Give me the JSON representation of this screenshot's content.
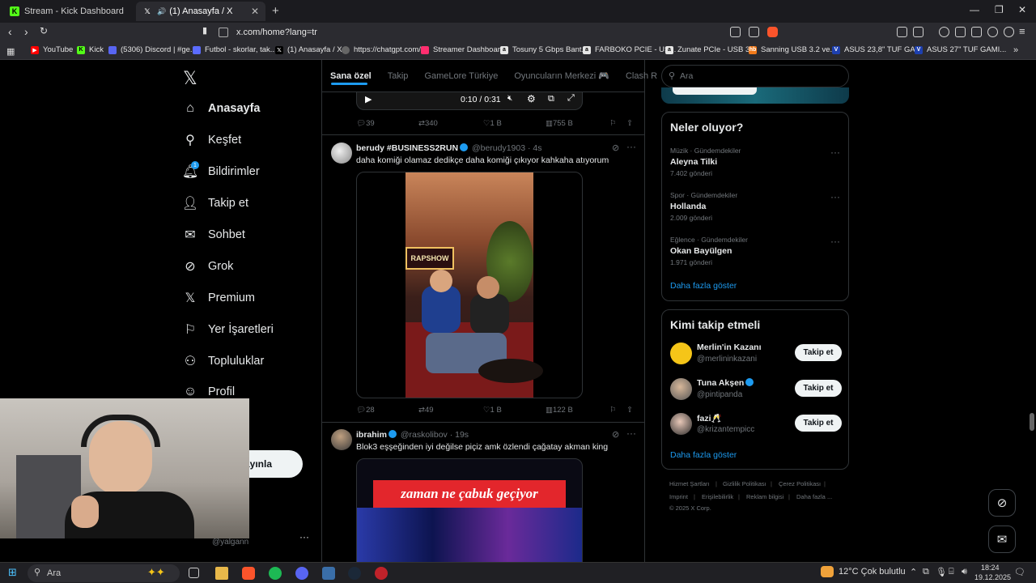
{
  "tabs": [
    {
      "label": "Stream - Kick Dashboard",
      "icon": "kick-icon",
      "color": "#53fc18"
    },
    {
      "label": "(1) Anasayfa / X",
      "icon": "x-logo-icon",
      "color": "#ffffff"
    }
  ],
  "url": "x.com/home?lang=tr",
  "bookmarks": [
    {
      "label": "YouTube",
      "color": "#ff0000"
    },
    {
      "label": "Kick",
      "color": "#53fc18"
    },
    {
      "label": "(5306) Discord | #ge...",
      "color": "#5865f2"
    },
    {
      "label": "Futbol - skorlar, tak...",
      "color": "#5b6cff"
    },
    {
      "label": "(1) Anasayfa / X",
      "color": "#444444"
    },
    {
      "label": "https://chatgpt.com/",
      "color": "#666666"
    },
    {
      "label": "Streamer Dashboard",
      "color": "#ff2e6f"
    },
    {
      "label": "Tosuny 5 Gbps Bant...",
      "color": "#e6e6e6"
    },
    {
      "label": "FARBOKO PCIE - US...",
      "color": "#e6e6e6"
    },
    {
      "label": "Zunate PCIe - USB 3...",
      "color": "#e6e6e6"
    },
    {
      "label": "Sanning USB 3.2 ve...",
      "color": "#f27a1a"
    },
    {
      "label": "ASUS 23,8\" TUF GA...",
      "color": "#1e40af"
    },
    {
      "label": "ASUS 27\" TUF GAMI...",
      "color": "#1e40af"
    }
  ],
  "nav": [
    {
      "label": "Anasayfa",
      "icon": "home-icon"
    },
    {
      "label": "Keşfet",
      "icon": "search-icon"
    },
    {
      "label": "Bildirimler",
      "icon": "bell-icon",
      "badge": "1"
    },
    {
      "label": "Takip et",
      "icon": "add-user-icon"
    },
    {
      "label": "Sohbet",
      "icon": "mail-icon"
    },
    {
      "label": "Grok",
      "icon": "grok-icon"
    },
    {
      "label": "Premium",
      "icon": "x-logo-icon"
    },
    {
      "label": "Yer İşaretleri",
      "icon": "bookmark-icon"
    },
    {
      "label": "Topluluklar",
      "icon": "communities-icon"
    },
    {
      "label": "Profil",
      "icon": "profile-icon"
    },
    {
      "label": "zla",
      "icon": ""
    }
  ],
  "post_button_partial": "ayınla",
  "account_handle_partial": "@yalgann",
  "feed_tabs": [
    "Sana özel",
    "Takip",
    "GameLore Türkiye",
    "Oyuncuların Merkezi 🎮",
    "Clash R"
  ],
  "video_time": "0:10 / 0:31",
  "tweets": [
    {
      "actions": {
        "replies": "39",
        "reposts": "340",
        "likes": "1 B",
        "views": "755 B"
      }
    },
    {
      "name": "berudy #BUSINESS2RUN",
      "verified": true,
      "handle": "@berudy1903 · 4s",
      "text": "daha komiği olamaz dedikçe daha komiği çıkıyor kahkaha atıyorum",
      "media_sign": "RAPSHOW",
      "actions": {
        "replies": "28",
        "reposts": "49",
        "likes": "1 B",
        "views": "122 B"
      }
    },
    {
      "name": "ibrahim",
      "verified": true,
      "handle": "@raskolibov · 19s",
      "text": "Blok3 eşşeğinden iyi değilse piçiz amk özlendi çağatay akman king",
      "media_caption": "zaman ne çabuk geçiyor"
    }
  ],
  "search_placeholder": "Ara",
  "trends": {
    "title": "Neler oluyor?",
    "items": [
      {
        "meta": "Müzik · Gündemdekiler",
        "topic": "Aleyna Tilki",
        "posts": "7.402 gönderi"
      },
      {
        "meta": "Spor · Gündemdekiler",
        "topic": "Hollanda",
        "posts": "2.009 gönderi"
      },
      {
        "meta": "Eğlence · Gündemdekiler",
        "topic": "Okan Bayülgen",
        "posts": "1.971 gönderi"
      }
    ],
    "show_more": "Daha fazla göster"
  },
  "who_to_follow": {
    "title": "Kimi takip etmeli",
    "items": [
      {
        "name": "Merlin'in Kazanı",
        "handle": "@merlininkazani",
        "verified": false,
        "button": "Takip et"
      },
      {
        "name": "Tuna Akşen",
        "handle": "@pintipanda",
        "verified": true,
        "button": "Takip et"
      },
      {
        "name": "fazi🥂",
        "handle": "@krizantempicc",
        "verified": false,
        "button": "Takip et"
      }
    ],
    "show_more": "Daha fazla göster"
  },
  "footer": {
    "links": [
      "Hizmet Şartları",
      "Gizlilik Politikası",
      "Çerez Politikası",
      "Imprint",
      "Erişilebilirlik",
      "Reklam bilgisi",
      "Daha fazla ..."
    ],
    "copyright": "© 2025 X Corp."
  },
  "taskbar": {
    "search": "Ara",
    "weather": "12°C  Çok bulutlu",
    "time": "18:24",
    "date": "19.12.2025"
  },
  "colors": {
    "x_blue": "#1d9bf0",
    "border": "#2f3336",
    "muted": "#71767b"
  }
}
